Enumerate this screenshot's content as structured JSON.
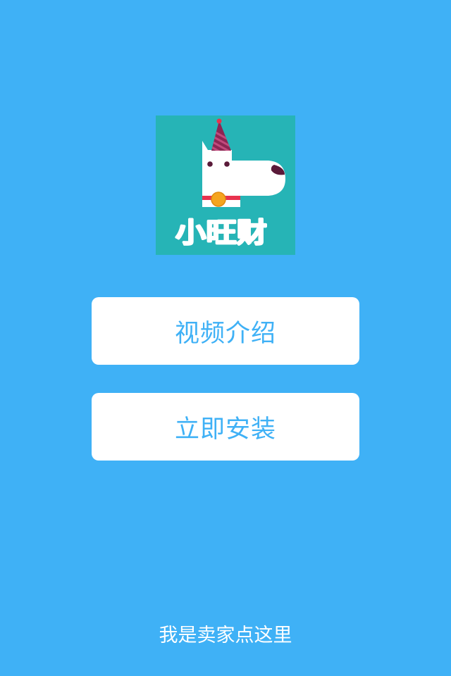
{
  "app": {
    "logo_text": "小旺财",
    "logo_icon": "dog-with-party-hat-icon"
  },
  "colors": {
    "background": "#3fb1f6",
    "logo_background": "#26b4b6",
    "button_background": "#ffffff",
    "button_text": "#3fb1f6",
    "link_text": "#ffffff",
    "hat": "#8c2653",
    "collar": "#e8334e",
    "bell": "#f5a51f",
    "nose": "#5a1a39"
  },
  "buttons": {
    "video_intro": "视频介绍",
    "install_now": "立即安装"
  },
  "footer": {
    "seller_link": "我是卖家点这里"
  }
}
